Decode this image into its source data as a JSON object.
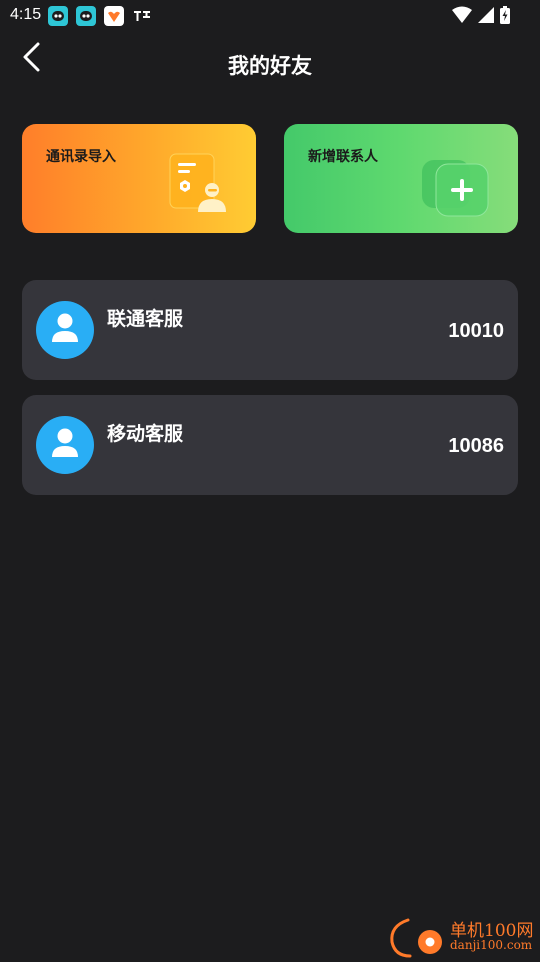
{
  "status_bar": {
    "time": "4:15",
    "icons": [
      "app-notification-icon",
      "app-notification-icon",
      "app-notification-icon",
      "signal-app-icon",
      "wifi-icon",
      "cell-signal-icon",
      "battery-icon"
    ]
  },
  "header": {
    "title": "我的好友",
    "back_icon": "chevron-left-icon"
  },
  "actions": [
    {
      "label": "通讯录导入",
      "icon": "contact-import-icon",
      "color": "#ff9f2b"
    },
    {
      "label": "新增联系人",
      "icon": "add-contact-icon",
      "color": "#5fd96f"
    }
  ],
  "contacts": [
    {
      "name": "联通客服",
      "number": "10010",
      "avatar_icon": "person-icon"
    },
    {
      "name": "移动客服",
      "number": "10086",
      "avatar_icon": "person-icon"
    }
  ],
  "watermark": {
    "name": "单机100网",
    "url": "danji100.com"
  },
  "colors": {
    "background": "#1c1c1e",
    "card_background": "#35353b",
    "avatar": "#29aef5",
    "accent_orange": "#ff7a2a"
  }
}
